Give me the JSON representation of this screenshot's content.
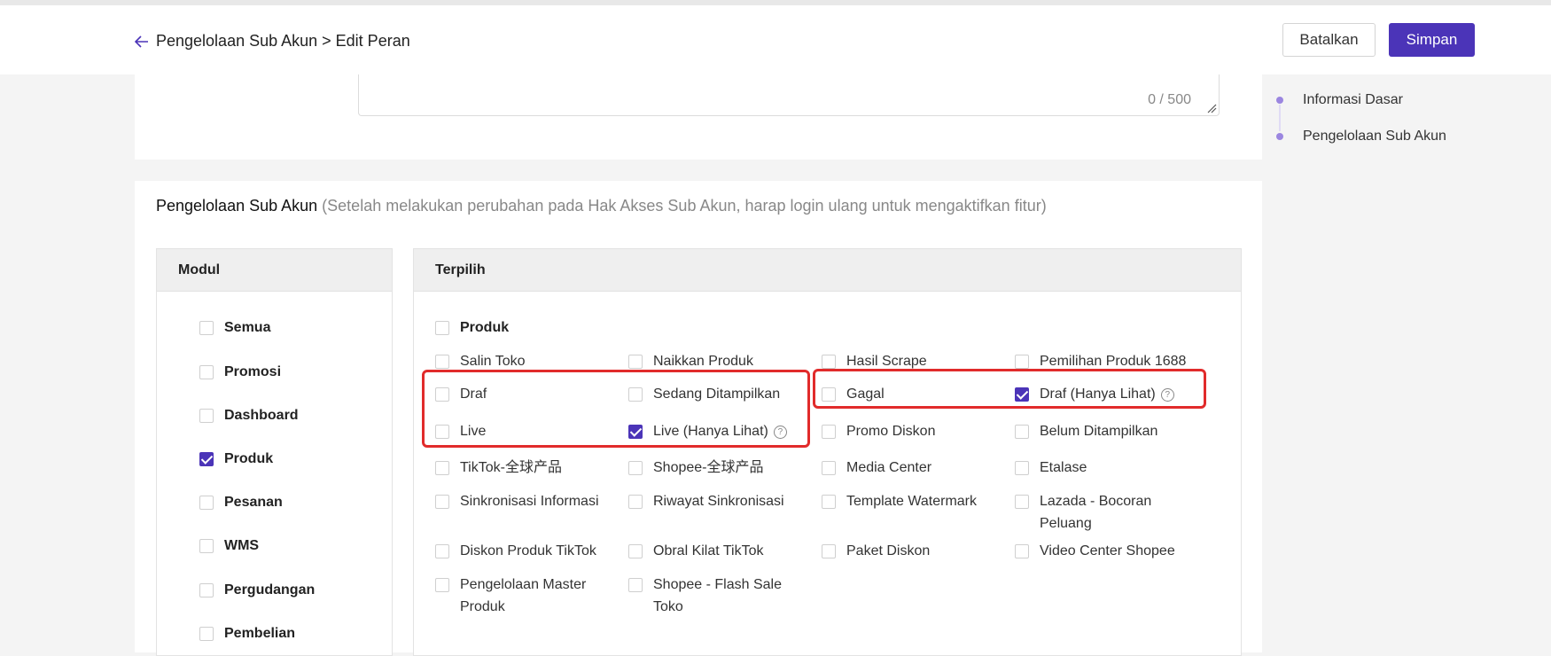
{
  "header": {
    "breadcrumb": "Pengelolaan Sub Akun > Edit Peran",
    "cancel_label": "Batalkan",
    "save_label": "Simpan"
  },
  "description": {
    "counter": "0 / 500"
  },
  "section": {
    "title": "Pengelolaan Sub Akun",
    "hint": "(Setelah melakukan perubahan pada Hak Akses Sub Akun, harap login ulang untuk mengaktifkan fitur)"
  },
  "modul": {
    "header": "Modul",
    "items": [
      {
        "label": "Semua",
        "checked": false
      },
      {
        "label": "Promosi",
        "checked": false
      },
      {
        "label": "Dashboard",
        "checked": false
      },
      {
        "label": "Produk",
        "checked": true
      },
      {
        "label": "Pesanan",
        "checked": false
      },
      {
        "label": "WMS",
        "checked": false
      },
      {
        "label": "Pergudangan",
        "checked": false
      },
      {
        "label": "Pembelian",
        "checked": false
      }
    ]
  },
  "terpilih": {
    "header": "Terpilih",
    "group": "Produk",
    "items": [
      {
        "label": "Salin Toko",
        "checked": false
      },
      {
        "label": "Naikkan Produk",
        "checked": false
      },
      {
        "label": "Hasil Scrape",
        "checked": false
      },
      {
        "label": "Pemilihan Produk 1688",
        "checked": false
      },
      {
        "label": "Draf",
        "checked": false
      },
      {
        "label": "Sedang Ditampilkan",
        "checked": false
      },
      {
        "label": "Gagal",
        "checked": false
      },
      {
        "label": "Draf (Hanya Lihat)",
        "checked": true,
        "help": "?"
      },
      {
        "label": "Live",
        "checked": false
      },
      {
        "label": "Live (Hanya Lihat)",
        "checked": true,
        "help": "?"
      },
      {
        "label": "Promo Diskon",
        "checked": false
      },
      {
        "label": "Belum Ditampilkan",
        "checked": false
      },
      {
        "label": "TikTok-全球产品",
        "checked": false
      },
      {
        "label": "Shopee-全球产品",
        "checked": false
      },
      {
        "label": "Media Center",
        "checked": false
      },
      {
        "label": "Etalase",
        "checked": false
      },
      {
        "label": "Sinkronisasi Informasi",
        "checked": false
      },
      {
        "label": "Riwayat Sinkronisasi",
        "checked": false
      },
      {
        "label": "Template Watermark",
        "checked": false
      },
      {
        "label": "Lazada - Bocoran",
        "label2": "Peluang",
        "checked": false
      },
      {
        "label": "Diskon Produk TikTok",
        "checked": false
      },
      {
        "label": "Obral Kilat TikTok",
        "checked": false
      },
      {
        "label": "Paket Diskon",
        "checked": false
      },
      {
        "label": "Video Center Shopee",
        "checked": false
      },
      {
        "label": "Pengelolaan Master",
        "label2": "Produk",
        "checked": false
      },
      {
        "label": "Shopee - Flash Sale",
        "label2": "Toko",
        "checked": false
      }
    ]
  },
  "steps": [
    "Informasi Dasar",
    "Pengelolaan Sub Akun"
  ],
  "colors": {
    "accent": "#4b34b8",
    "highlight": "#e12b2b"
  }
}
